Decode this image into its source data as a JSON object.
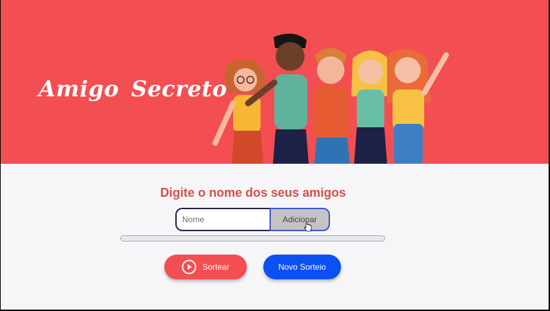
{
  "header": {
    "title": "Amigo Secreto",
    "background_color": "#f34e52",
    "illustration_icon": "group-of-friends-illustration"
  },
  "main": {
    "subtitle": "Digite o nome dos seus amigos",
    "name_input": {
      "placeholder": "Nome",
      "value": ""
    },
    "add_button_label": "Adicionar",
    "progress": {
      "value": 0
    },
    "draw_button": {
      "label": "Sortear",
      "icon": "play-circle-icon",
      "color": "#f34e52"
    },
    "new_draw_button": {
      "label": "Novo Sorteio",
      "color": "#0b50f2"
    }
  },
  "colors": {
    "accent_red": "#f34e52",
    "accent_blue": "#0b50f2",
    "subtitle": "#d4504a"
  }
}
